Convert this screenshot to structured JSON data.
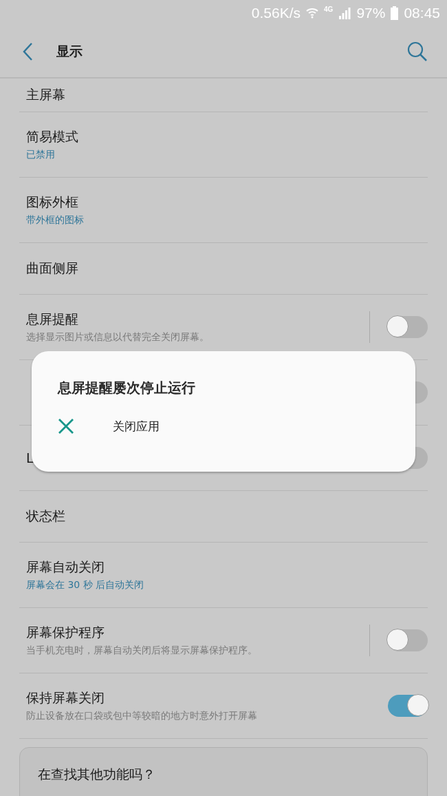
{
  "status_bar": {
    "speed": "0.56K/s",
    "network": "4G",
    "battery": "97%",
    "time": "08:45"
  },
  "app_bar": {
    "title": "显示"
  },
  "rows": [
    {
      "kind": "clipped",
      "title": "主屏幕"
    },
    {
      "kind": "value",
      "title": "简易模式",
      "subtitle": "已禁用"
    },
    {
      "kind": "value",
      "title": "图标外框",
      "subtitle": "带外框的图标"
    },
    {
      "kind": "plain",
      "title": "曲面侧屏"
    },
    {
      "kind": "toggle",
      "title": "息屏提醒",
      "subtitle": "选择显示图片或信息以代替完全关闭屏幕。",
      "on": false,
      "divider": true
    },
    {
      "kind": "covered",
      "on": false
    },
    {
      "kind": "covered",
      "title": "L",
      "on": false
    },
    {
      "kind": "plain",
      "title": "状态栏"
    },
    {
      "kind": "value",
      "title": "屏幕自动关闭",
      "subtitle": "屏幕会在 30 秒 后自动关闭"
    },
    {
      "kind": "toggle",
      "title": "屏幕保护程序",
      "subtitle": "当手机充电时，屏幕自动关闭后将显示屏幕保护程序。",
      "on": false,
      "divider": true
    },
    {
      "kind": "toggle",
      "title": "保持屏幕关闭",
      "subtitle": "防止设备放在口袋或包中等较暗的地方时意外打开屏幕",
      "on": true
    }
  ],
  "suggestion_card": {
    "title": "在查找其他功能吗？"
  },
  "dialog": {
    "title": "息屏提醒屡次停止运行",
    "actions": [
      {
        "label": "关闭应用"
      }
    ]
  }
}
